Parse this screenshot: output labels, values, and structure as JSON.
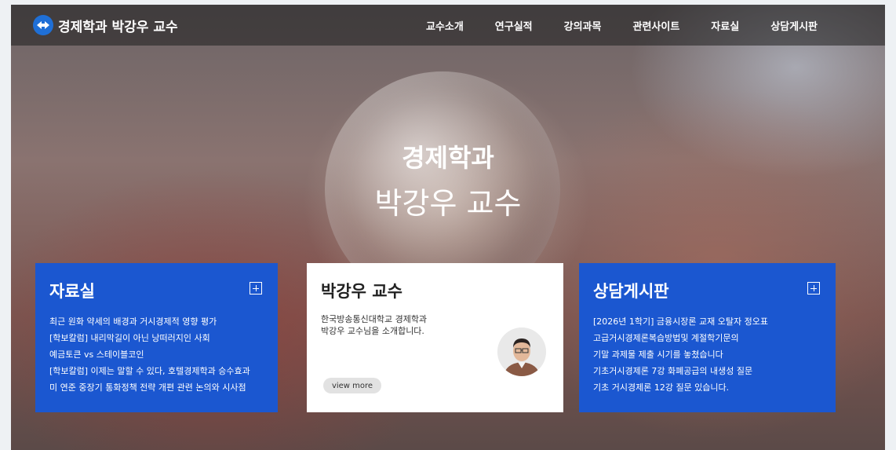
{
  "header": {
    "logo_text": "경제학과 박강우 교수",
    "nav": [
      "교수소개",
      "연구실적",
      "강의과목",
      "관련사이트",
      "자료실",
      "상담게시판"
    ]
  },
  "hero": {
    "line1": "경제학과",
    "line2": "박강우 교수"
  },
  "cards": {
    "left": {
      "title": "자료실",
      "items": [
        "최근 원화 약세의 배경과 거시경제적 영향 평가",
        "[학보칼럼] 내리막길이 아닌 낭떠러지인 사회",
        "예금토큰 vs 스테이블코인",
        "[학보칼럼] 이제는 말할 수 있다, 호텔경제학과 승수효과",
        "미 연준 중장기 통화정책 전략 개편 관련 논의와 시사점"
      ]
    },
    "middle": {
      "title": "박강우 교수",
      "desc_line1": "한국방송통신대학교 경제학과",
      "desc_line2": "박강우 교수님을 소개합니다.",
      "button": "view more"
    },
    "right": {
      "title": "상담게시판",
      "items": [
        "[2026년 1학기] 금융시장론 교재 오탈자 정오표",
        "고급거시경제론복습방법및 계절학기문의",
        "기말 과제물 제출 시기를 놓쳤습니다",
        "기초거시경제론 7강 화폐공급의 내생성 질문",
        "기초 거시경제론 12강 질문 있습니다."
      ]
    }
  },
  "colors": {
    "accent_blue": "#1b57d0",
    "logo_blue": "#1f6fd6"
  }
}
